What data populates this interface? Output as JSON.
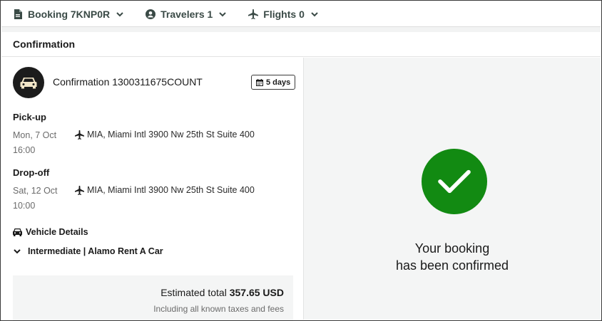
{
  "nav": {
    "booking_label": "Booking 7KNP0R",
    "travelers_label": "Travelers 1",
    "flights_label": "Flights 0"
  },
  "section": {
    "title": "Confirmation"
  },
  "reservation": {
    "confirmation_text": "Confirmation 1300311675COUNT",
    "duration_badge": "5 days",
    "pickup": {
      "heading": "Pick-up",
      "date": "Mon, 7 Oct",
      "time": "16:00",
      "location": "MIA, Miami Intl 3900 Nw 25th St Suite 400"
    },
    "dropoff": {
      "heading": "Drop-off",
      "date": "Sat, 12 Oct",
      "time": "10:00",
      "location": "MIA, Miami Intl 3900 Nw 25th St Suite 400"
    },
    "vehicle_details_label": "Vehicle Details",
    "vehicle_summary": "Intermediate | Alamo Rent A Car"
  },
  "totals": {
    "estimated_prefix": "Estimated total",
    "estimated_amount": "357.65 USD",
    "note": "Including all known taxes and fees"
  },
  "confirmation": {
    "line1": "Your booking",
    "line2": "has been confirmed"
  },
  "colors": {
    "success": "#128a12",
    "nav_text": "#3a4a46",
    "avatar_bg": "#1c1c1c",
    "panel_bg": "#f4f5f5"
  },
  "icons": {
    "booking": "document-icon",
    "travelers": "user-circle-icon",
    "flights": "airplane-icon",
    "avatar": "car-icon",
    "badge": "calendar-icon",
    "vehicle": "car-icon",
    "toggle": "chevron-down-icon",
    "confirm": "checkmark-icon"
  }
}
